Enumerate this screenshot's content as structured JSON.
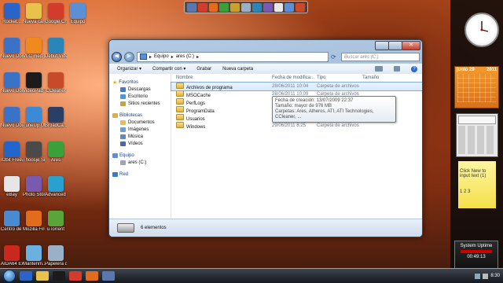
{
  "desktop": {
    "icons": [
      {
        "label": "Rocket...",
        "color": "#2a64c8"
      },
      {
        "label": "Nueva carpeta",
        "color": "#e8c24a"
      },
      {
        "label": "Google Chrome",
        "color": "#d33b2c"
      },
      {
        "label": "Equipo",
        "color": "#5b8fd6"
      },
      {
        "label": "Nuevo Docum...",
        "color": "#3a72c8"
      },
      {
        "label": "VLC med...",
        "color": "#f08a1c"
      },
      {
        "label": "Debut Video ...",
        "color": "#2a86b8"
      },
      {
        "label": "Nuevo Docum...",
        "color": "#3a72c8"
      },
      {
        "label": "VideoPad Video E...",
        "color": "#1b1b1b"
      },
      {
        "label": "CCleaner",
        "color": "#c84a2a"
      },
      {
        "label": "Nuevo Docum...",
        "color": "#3a72c8"
      },
      {
        "label": "TuneUp Utiliti...",
        "color": "#3a8ad6"
      },
      {
        "label": "BroadCa... Classics",
        "color": "#2b3f66"
      },
      {
        "label": "IObit Freeware",
        "color": "#2266cc"
      },
      {
        "label": "Thoosje Sidebar",
        "color": "#4a4a4a"
      },
      {
        "label": "Ares",
        "color": "#3aa03a"
      },
      {
        "label": "eBay",
        "color": "#e6e6e6"
      },
      {
        "label": "Photo Story 3 for...",
        "color": "#7a5ab0"
      },
      {
        "label": "Advanced SystemC...",
        "color": "#2aa0d0"
      },
      {
        "label": "Centro de movilida...",
        "color": "#4a8ad0"
      },
      {
        "label": "Mozilla Firefox",
        "color": "#e36b1c"
      },
      {
        "label": "uTorrent",
        "color": "#5aa53a"
      },
      {
        "label": "AIDA64 Extre...",
        "color": "#c8281e"
      },
      {
        "label": "Mantenm... con 1 clic",
        "color": "#6ab0e0"
      },
      {
        "label": "Papelera de recicl...",
        "color": "#9ab0c8"
      }
    ]
  },
  "explorer": {
    "path": [
      "Equipo",
      "ares (C:)"
    ],
    "search_placeholder": "Buscar ares (C:)",
    "toolbar": [
      "Organizar ▾",
      "Compartir con ▾",
      "Grabar",
      "Nueva carpeta"
    ],
    "nav": {
      "favorites_header": "Favoritos",
      "favorites": [
        "Descargas",
        "Escritorio",
        "Sitios recientes"
      ],
      "libraries_header": "Bibliotecas",
      "libraries": [
        "Documentos",
        "Imágenes",
        "Música",
        "Vídeos"
      ],
      "computer_header": "Equipo",
      "computer": [
        "ares (C:)"
      ],
      "network_header": "Red"
    },
    "columns": [
      "Nombre",
      "Fecha de modifica...",
      "Tipo",
      "Tamaño"
    ],
    "rows": [
      {
        "name": "Archivos de programa",
        "date": "28/06/2011 10:04",
        "type": "Carpeta de archivos"
      },
      {
        "name": "MSOCache",
        "date": "28/06/2011 10:09",
        "type": "Carpeta de archivos"
      },
      {
        "name": "PerfLogs",
        "date": "",
        "type": "Carpeta de archivos"
      },
      {
        "name": "ProgramData",
        "date": "",
        "type": "Carpeta de archivos"
      },
      {
        "name": "Usuarios",
        "date": "28/06/2011 8:22",
        "type": "Carpeta de archivos"
      },
      {
        "name": "Windows",
        "date": "29/06/2011 8:25",
        "type": "Carpeta de archivos"
      }
    ],
    "tooltip": [
      "Fecha de creación: 13/07/2009 22:37",
      "Tamaño: mayor de 976 MB",
      "Carpetas: Ares, Atheros, ATI, ATI Technologies, CCleaner, ..."
    ],
    "status": "6 elementos"
  },
  "gadgets": {
    "calendar_month": "junio 29",
    "calendar_year": "2011",
    "note_text": "Click New to input text (1)",
    "note_pages": "1 2 3",
    "uptime_title": "System Uptime",
    "uptime_value": "00:49:13"
  },
  "taskbar": {
    "clock": "8:30"
  }
}
